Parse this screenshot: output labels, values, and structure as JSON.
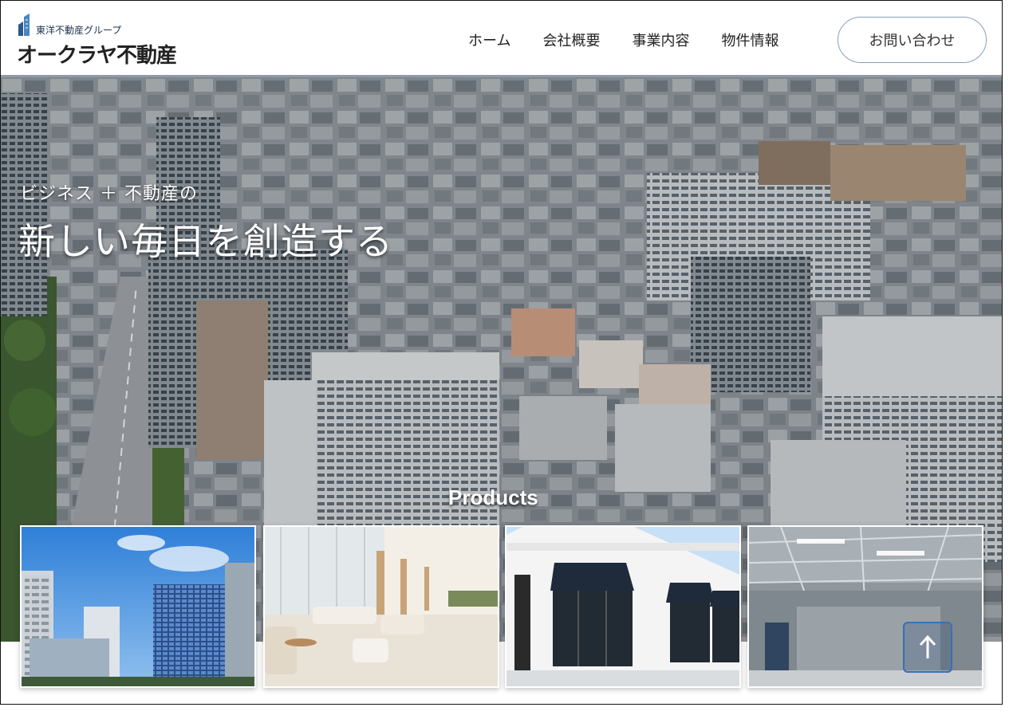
{
  "header": {
    "logo_sub": "東洋不動産グループ",
    "logo_main": "オークラヤ不動産",
    "nav": [
      "ホーム",
      "会社概要",
      "事業内容",
      "物件情報"
    ],
    "contact_label": "お問い合わせ"
  },
  "hero": {
    "subtitle": "ビジネス ＋ 不動産の",
    "title": "新しい毎日を創造する"
  },
  "products": {
    "heading": "Products",
    "cards": [
      "office-buildings",
      "lounge-interior",
      "storefront",
      "warehouse"
    ]
  },
  "scroll_top": {
    "icon": "arrow-up-icon"
  },
  "colors": {
    "header_border": "#8e9aa6",
    "contact_border": "#8aa0b8",
    "scroll_top_border": "#3a6fb4"
  }
}
